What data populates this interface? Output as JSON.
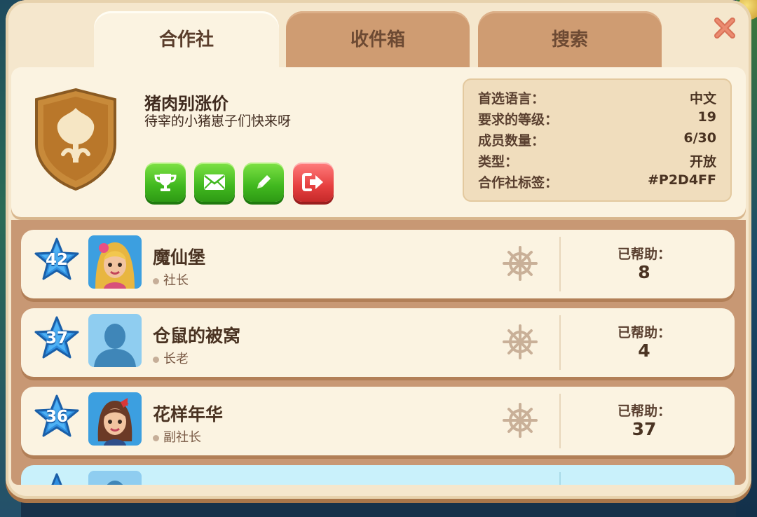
{
  "tabs": [
    {
      "label": "合作社",
      "active": true
    },
    {
      "label": "收件箱",
      "active": false
    },
    {
      "label": "搜索",
      "active": false
    }
  ],
  "club": {
    "name": "猪肉别涨价",
    "description": "待宰的小猪崽子们快来呀",
    "emblem_icon": "tulip-shield-icon",
    "actions": [
      {
        "icon": "trophy-icon",
        "color": "#41b81f"
      },
      {
        "icon": "mail-icon",
        "color": "#41b81f"
      },
      {
        "icon": "edit-pencil-icon",
        "color": "#41b81f"
      },
      {
        "icon": "exit-door-icon",
        "color": "#e64040"
      }
    ]
  },
  "stats": [
    {
      "key": "首选语言：",
      "value": "中文"
    },
    {
      "key": "要求的等级：",
      "value": "19"
    },
    {
      "key": "成员数量：",
      "value": "6/30"
    },
    {
      "key": "类型：",
      "value": "开放"
    },
    {
      "key": "合作社标签：",
      "value": "#P2D4FF"
    }
  ],
  "members": [
    {
      "level": "42",
      "name": "魔仙堡",
      "role": "社长",
      "help_label": "已帮助：",
      "help_count": "8",
      "avatar": "blonde-girl-avatar"
    },
    {
      "level": "37",
      "name": "仓鼠的被窝",
      "role": "长老",
      "help_label": "已帮助：",
      "help_count": "4",
      "avatar": "default-silhouette-avatar"
    },
    {
      "level": "36",
      "name": "花样年华",
      "role": "副社长",
      "help_label": "已帮助：",
      "help_count": "37",
      "avatar": "brunette-girl-avatar"
    }
  ],
  "colors": {
    "panel": "#f5e7cd",
    "list_bg": "#c89874",
    "star_blue": "#2f8fe0",
    "green_button": "#41b81f",
    "red_button": "#e64040",
    "highlight_row": "#c9f1fb"
  }
}
